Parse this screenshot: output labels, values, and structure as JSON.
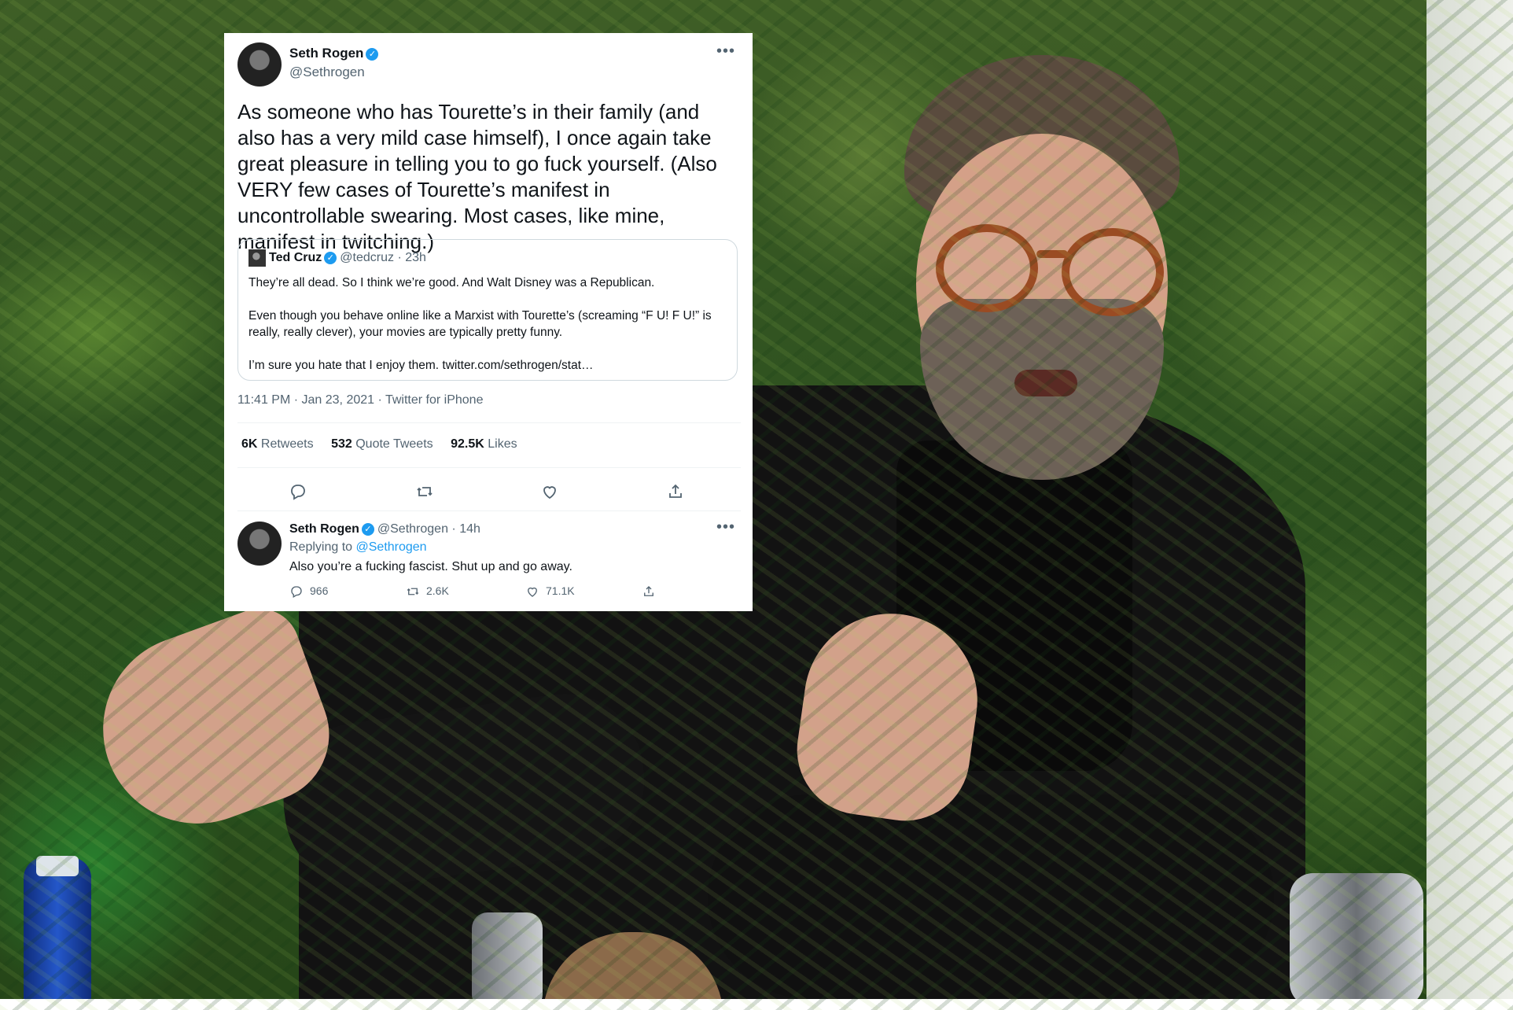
{
  "tweet": {
    "author_name": "Seth Rogen",
    "author_handle": "@Sethrogen",
    "text": "As someone who has Tourette’s in their family (and also has a very mild case himself), I once again take great pleasure in telling you to go fuck yourself. (Also VERY few cases of Tourette’s manifest in uncontrollable swearing. Most cases, like mine, manifest in twitching.)",
    "more": "•••",
    "meta": "11:41 PM · Jan 23, 2021 · Twitter for iPhone",
    "stats": {
      "retweets_count": "6K",
      "retweets_label": "Retweets",
      "quotes_count": "532",
      "quotes_label": "Quote Tweets",
      "likes_count": "92.5K",
      "likes_label": "Likes"
    }
  },
  "quoted": {
    "author_name": "Ted Cruz",
    "author_handle": "@tedcruz",
    "time": "· 23h",
    "p1": "They’re all dead. So I think we’re good. And Walt Disney was a Republican.",
    "p2": "Even though you behave online like a Marxist with Tourette’s (screaming “F U! F U!” is really, really clever), your movies are typically pretty funny.",
    "p3": "I’m sure you hate that I enjoy them. twitter.com/sethrogen/stat…"
  },
  "reply": {
    "author_name": "Seth Rogen",
    "author_handle": "@Sethrogen",
    "time": "· 14h",
    "replying_prefix": "Replying to",
    "replying_to": "@Sethrogen",
    "text": "Also you’re a fucking fascist. Shut up and go away.",
    "reply_count": "966",
    "retweet_count": "2.6K",
    "like_count": "71.1K",
    "more": "•••"
  },
  "icons": {
    "verified": "verified-badge-icon",
    "reply": "reply-bubble-icon",
    "retweet": "retweet-arrows-icon",
    "like": "heart-icon",
    "share": "share-upload-icon"
  },
  "colors": {
    "link": "#1d9bf0",
    "secondary_text": "#536471",
    "primary_text": "#0f1419"
  }
}
